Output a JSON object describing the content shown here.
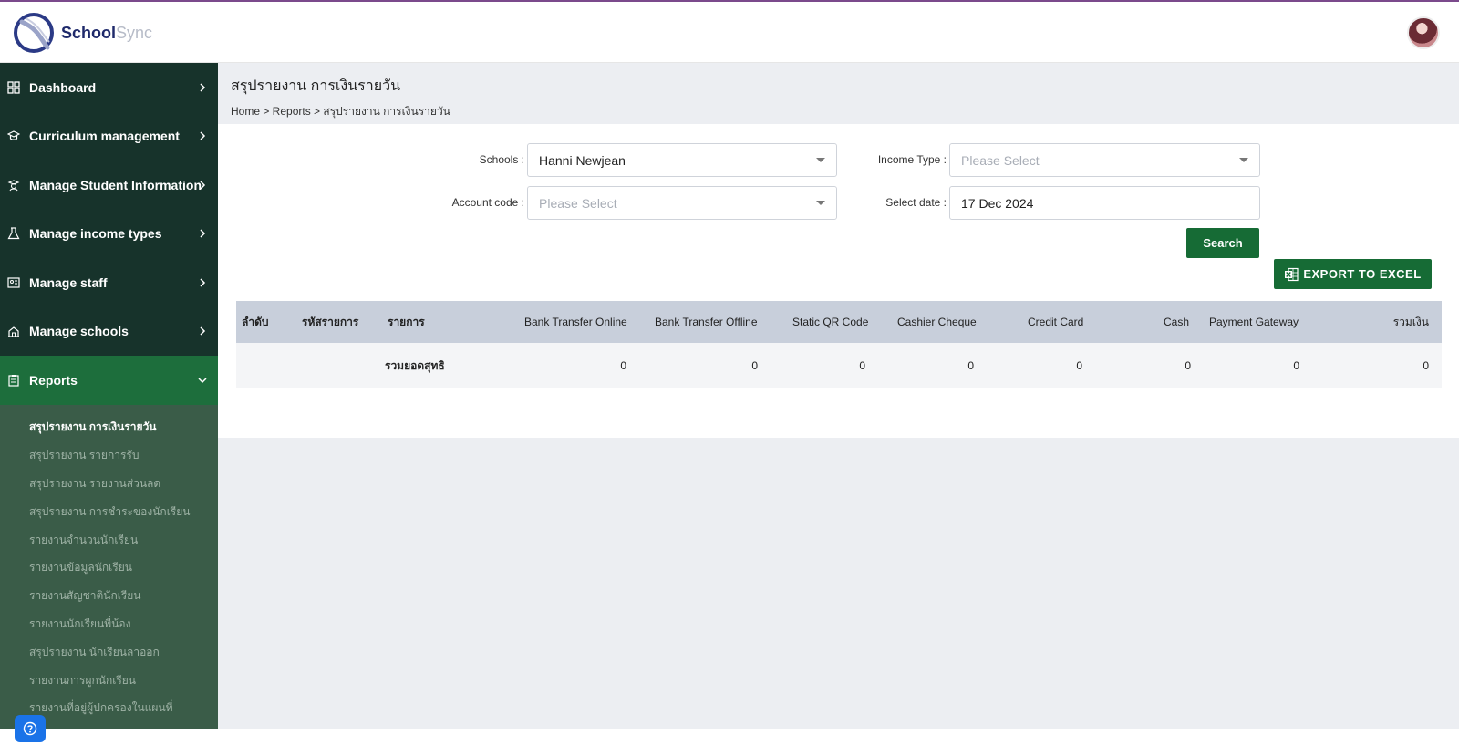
{
  "brand": {
    "name_part1": "School",
    "name_part2": "Sync"
  },
  "sidebar": {
    "items": [
      {
        "label": "Dashboard",
        "icon": "grid-icon"
      },
      {
        "label": "Curriculum management",
        "icon": "graduation-cap-icon"
      },
      {
        "label": "Manage Student Information",
        "icon": "student-icon"
      },
      {
        "label": "Manage income types",
        "icon": "flask-icon"
      },
      {
        "label": "Manage staff",
        "icon": "id-card-icon"
      },
      {
        "label": "Manage schools",
        "icon": "school-icon"
      },
      {
        "label": "Reports",
        "icon": "clipboard-icon"
      }
    ],
    "reports_submenu": [
      "สรุปรายงาน การเงินรายวัน",
      "สรุปรายงาน รายการรับ",
      "สรุปรายงาน รายงานส่วนลด",
      "สรุปรายงาน การชำระของนักเรียน",
      "รายงานจำนวนนักเรียน",
      "รายงานข้อมูลนักเรียน",
      "รายงานสัญชาตินักเรียน",
      "รายงานนักเรียนพี่น้อง",
      "สรุปรายงาน นักเรียนลาออก",
      "รายงานการผูกนักเรียน",
      "รายงานที่อยู่ผู้ปกครองในแผนที่"
    ]
  },
  "page": {
    "title": "สรุปรายงาน การเงินรายวัน",
    "breadcrumb": "Home > Reports > สรุปรายงาน การเงินรายวัน"
  },
  "filters": {
    "schools_label": "Schools :",
    "schools_value": "Hanni Newjean",
    "income_type_label": "Income Type :",
    "income_type_placeholder": "Please Select",
    "account_code_label": "Account code :",
    "account_code_placeholder": "Please Select",
    "select_date_label": "Select date :",
    "select_date_value": "17 Dec 2024"
  },
  "buttons": {
    "search": "Search",
    "export": "EXPORT TO EXCEL"
  },
  "table": {
    "headers": [
      "ลำดับ",
      "รหัสรายการ",
      "รายการ",
      "Bank Transfer Online",
      "Bank Transfer Offline",
      "Static QR Code",
      "Cashier Cheque",
      "Credit Card",
      "Cash",
      "Payment Gateway",
      "รวมเงิน"
    ],
    "total_row": {
      "label": "รวมยอดสุทธิ",
      "values": [
        "0",
        "0",
        "0",
        "0",
        "0",
        "0",
        "0",
        "0"
      ]
    }
  },
  "colors": {
    "sidebar_bg": "#17332b",
    "sidebar_active": "#1d6e3c",
    "submenu_bg": "#3a5c48",
    "button_green": "#166b35",
    "table_header": "#c8cfdb"
  }
}
